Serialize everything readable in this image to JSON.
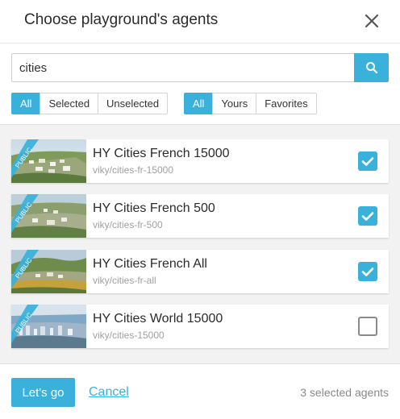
{
  "dialog": {
    "title": "Choose playground's agents"
  },
  "search": {
    "value": "cities"
  },
  "filters": {
    "selection": [
      {
        "label": "All",
        "active": true
      },
      {
        "label": "Selected",
        "active": false
      },
      {
        "label": "Unselected",
        "active": false
      }
    ],
    "ownership": [
      {
        "label": "All",
        "active": true
      },
      {
        "label": "Yours",
        "active": false
      },
      {
        "label": "Favorites",
        "active": false
      }
    ]
  },
  "agents": [
    {
      "name": "HY Cities French 15000",
      "slug": "viky/cities-fr-15000",
      "badge": "PUBLIC",
      "selected": true
    },
    {
      "name": "HY Cities French 500",
      "slug": "viky/cities-fr-500",
      "badge": "PUBLIC",
      "selected": true
    },
    {
      "name": "HY Cities French All",
      "slug": "viky/cities-fr-all",
      "badge": "PUBLIC",
      "selected": true
    },
    {
      "name": "HY Cities World 15000",
      "slug": "viky/cities-15000",
      "badge": "PUBLIC",
      "selected": false
    }
  ],
  "footer": {
    "go_label": "Let's go",
    "cancel_label": "Cancel",
    "count_text": "3 selected agents"
  },
  "colors": {
    "accent": "#3ab1da",
    "badge": "#3ab1da"
  },
  "icons": {
    "close": "close-icon",
    "search": "search-icon",
    "check": "check-icon"
  }
}
